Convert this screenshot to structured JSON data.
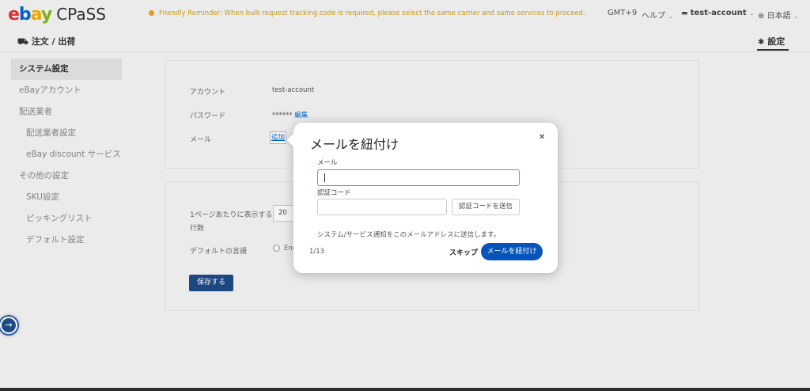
{
  "header": {
    "logo_text": "ebay",
    "brand": "CPaSS",
    "reminder": "Friendly Reminder: When bulk request tracking code is required, please select the same carrier and same services to proceed.",
    "timezone": "GMT+9",
    "help": "ヘルプ",
    "account": "test-account",
    "language": "日本語"
  },
  "subheader": {
    "orders": "注文 / 出荷",
    "settings": "設定"
  },
  "sidebar": {
    "items": [
      {
        "label": "システム設定"
      },
      {
        "label": "eBayアカウント"
      },
      {
        "label": "配送業者"
      },
      {
        "label": "配送業者設定"
      },
      {
        "label": "eBay discount サービス"
      },
      {
        "label": "その他の設定"
      },
      {
        "label": "SKU設定"
      },
      {
        "label": "ピッキングリスト"
      },
      {
        "label": "デフォルト設定"
      }
    ]
  },
  "account_panel": {
    "account_label": "アカウント",
    "account_value": "test-account",
    "password_label": "パスワード",
    "password_value": "******",
    "edit_link": "編集",
    "email_label": "メール",
    "add_link": "追加"
  },
  "settings_panel": {
    "rows_label_1": "1ページあたりに表示する",
    "rows_label_2": "行数",
    "rows_value": "20",
    "default_lang_label": "デフォルトの言語",
    "lang_option": "Eng",
    "save_button": "保存する"
  },
  "modal": {
    "title": "メールを紐付け",
    "email_label": "メール",
    "email_value": "",
    "code_label": "認証コード",
    "code_value": "",
    "send_code_button": "認証コードを送信",
    "notice": "システム/サービス通知をこのメールアドレスに送信します。",
    "step": "1/13",
    "skip_button": "スキップ",
    "link_button": "メールを紐付け"
  },
  "colors": {
    "primary": "#0654ba",
    "save_button": "#1e4a86",
    "reminder": "#d4a017"
  }
}
